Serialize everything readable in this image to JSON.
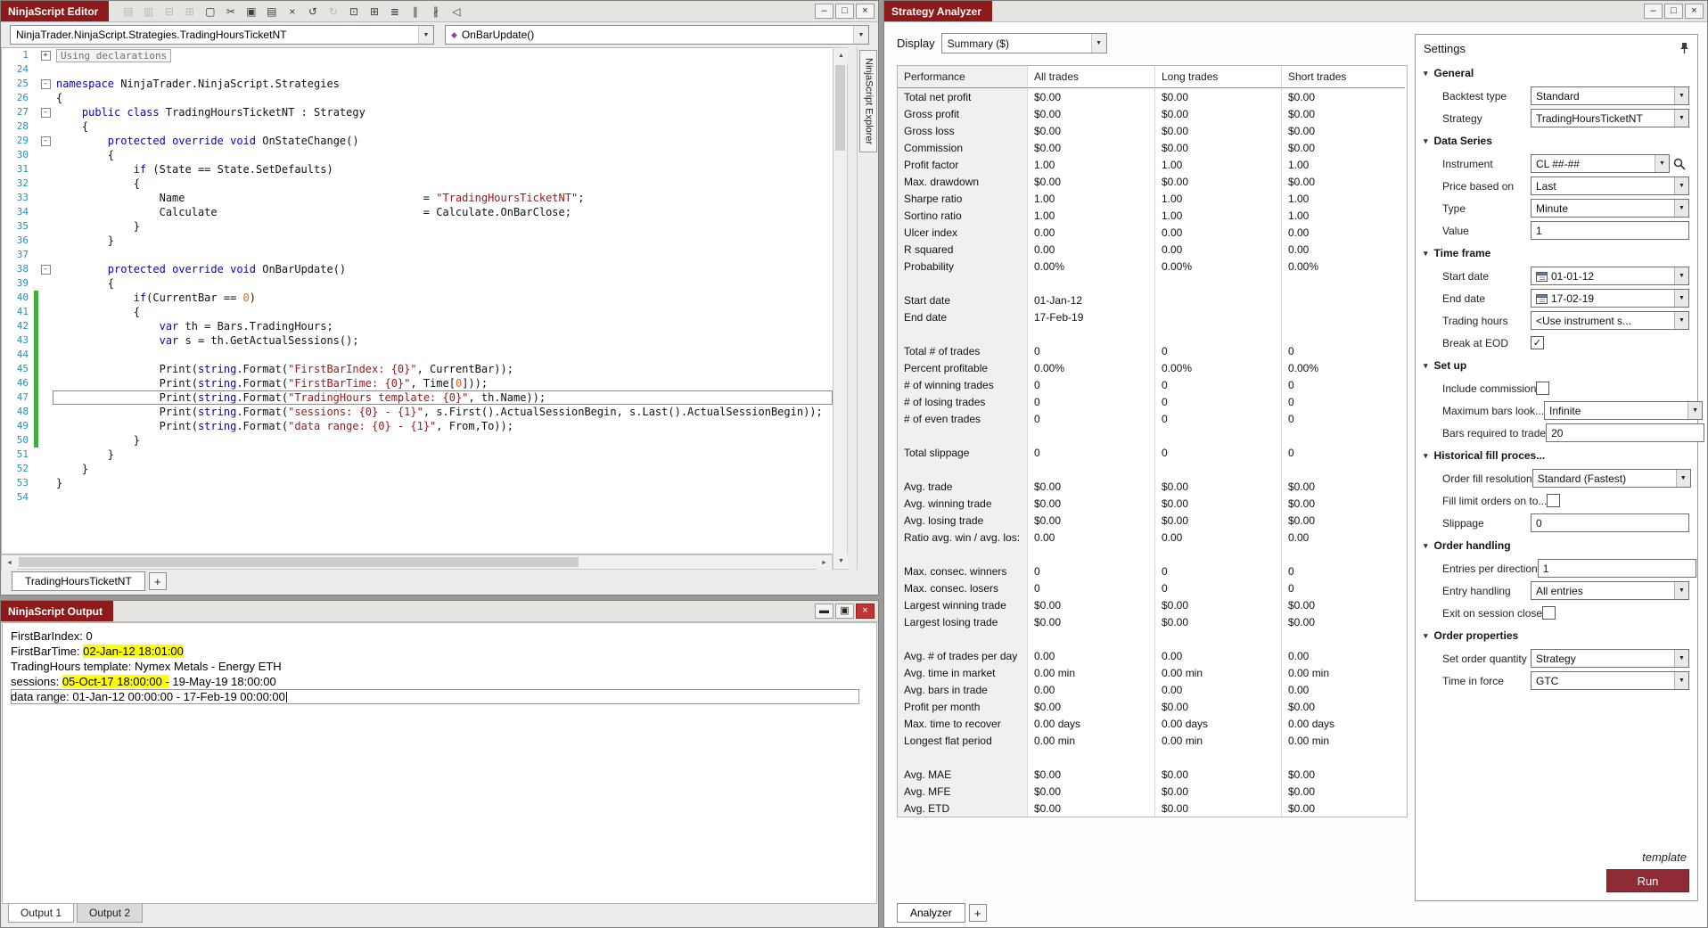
{
  "chrome": {
    "minimize": "–",
    "maximize": "□",
    "close": "×"
  },
  "editor": {
    "title": "NinjaScript Editor",
    "class_dropdown": "NinjaTrader.NinjaScript.Strategies.TradingHoursTicketNT",
    "method_dropdown": "OnBarUpdate()",
    "explorer_label": "NinjaScript Explorer",
    "tab": "TradingHoursTicketNT",
    "plus": "+",
    "toolbar": [
      {
        "name": "save-icon",
        "glyph": "▤",
        "disabled": true
      },
      {
        "name": "save-all-icon",
        "glyph": "▥",
        "disabled": true
      },
      {
        "name": "print-icon",
        "glyph": "⊟",
        "disabled": true
      },
      {
        "name": "print-preview-icon",
        "glyph": "⊞",
        "disabled": true
      },
      {
        "name": "new-file-icon",
        "glyph": "▢",
        "disabled": false
      },
      {
        "name": "cut-icon",
        "glyph": "✂",
        "disabled": false
      },
      {
        "name": "copy-icon",
        "glyph": "▣",
        "disabled": false
      },
      {
        "name": "paste-icon",
        "glyph": "▤",
        "disabled": false
      },
      {
        "name": "delete-icon",
        "glyph": "×",
        "disabled": false
      },
      {
        "name": "undo-icon",
        "glyph": "↺",
        "disabled": false
      },
      {
        "name": "redo-icon",
        "glyph": "↻",
        "disabled": true
      },
      {
        "name": "insert-snippet-icon",
        "glyph": "⊡",
        "disabled": false
      },
      {
        "name": "insert-table-icon",
        "glyph": "⊞",
        "disabled": false
      },
      {
        "name": "indent-icon",
        "glyph": "≣",
        "disabled": false
      },
      {
        "name": "comment-icon",
        "glyph": "∥",
        "disabled": false
      },
      {
        "name": "uncomment-icon",
        "glyph": "∦",
        "disabled": false
      },
      {
        "name": "compile-icon",
        "glyph": "◁",
        "disabled": false
      }
    ],
    "code": [
      {
        "n": 1,
        "f": "+",
        "s": [
          [
            "Using declarations",
            "c"
          ]
        ]
      },
      {
        "n": 24,
        "s": []
      },
      {
        "n": 25,
        "f": "-",
        "s": [
          [
            "namespace",
            "k"
          ],
          [
            " NinjaTrader.NinjaScript.Strategies",
            "p"
          ]
        ]
      },
      {
        "n": 26,
        "s": [
          [
            "{",
            "p"
          ]
        ]
      },
      {
        "n": 27,
        "f": "-",
        "s": [
          [
            "    ",
            "p"
          ],
          [
            "public",
            "k"
          ],
          [
            " ",
            "p"
          ],
          [
            "class",
            "k"
          ],
          [
            " TradingHoursTicketNT : Strategy",
            "p"
          ]
        ]
      },
      {
        "n": 28,
        "s": [
          [
            "    {",
            "p"
          ]
        ]
      },
      {
        "n": 29,
        "f": "-",
        "s": [
          [
            "        ",
            "p"
          ],
          [
            "protected",
            "k"
          ],
          [
            " ",
            "p"
          ],
          [
            "override",
            "k"
          ],
          [
            " ",
            "p"
          ],
          [
            "void",
            "k"
          ],
          [
            " OnStateChange()",
            "p"
          ]
        ]
      },
      {
        "n": 30,
        "s": [
          [
            "        {",
            "p"
          ]
        ]
      },
      {
        "n": 31,
        "s": [
          [
            "            ",
            "p"
          ],
          [
            "if",
            "k"
          ],
          [
            " (State == State.SetDefaults)",
            "p"
          ]
        ]
      },
      {
        "n": 32,
        "s": [
          [
            "            {",
            "p"
          ]
        ]
      },
      {
        "n": 33,
        "s": [
          [
            "                Name                                     = ",
            "p"
          ],
          [
            "\"TradingHoursTicketNT\"",
            "s"
          ],
          [
            ";",
            "p"
          ]
        ]
      },
      {
        "n": 34,
        "s": [
          [
            "                Calculate                                = Calculate.OnBarClose;",
            "p"
          ]
        ]
      },
      {
        "n": 35,
        "s": [
          [
            "            }",
            "p"
          ]
        ]
      },
      {
        "n": 36,
        "s": [
          [
            "        }",
            "p"
          ]
        ]
      },
      {
        "n": 37,
        "s": []
      },
      {
        "n": 38,
        "f": "-",
        "s": [
          [
            "        ",
            "p"
          ],
          [
            "protected",
            "k"
          ],
          [
            " ",
            "p"
          ],
          [
            "override",
            "k"
          ],
          [
            " ",
            "p"
          ],
          [
            "void",
            "k"
          ],
          [
            " OnBarUpdate()",
            "p"
          ]
        ]
      },
      {
        "n": 39,
        "s": [
          [
            "        {",
            "p"
          ]
        ]
      },
      {
        "n": 40,
        "chg": true,
        "s": [
          [
            "            ",
            "p"
          ],
          [
            "if",
            "k"
          ],
          [
            "(CurrentBar == ",
            "p"
          ],
          [
            "0",
            "n"
          ],
          [
            ")",
            "p"
          ]
        ]
      },
      {
        "n": 41,
        "chg": true,
        "s": [
          [
            "            {",
            "p"
          ]
        ]
      },
      {
        "n": 42,
        "chg": true,
        "s": [
          [
            "                ",
            "p"
          ],
          [
            "var",
            "k"
          ],
          [
            " th = Bars.TradingHours;",
            "p"
          ]
        ]
      },
      {
        "n": 43,
        "chg": true,
        "s": [
          [
            "                ",
            "p"
          ],
          [
            "var",
            "k"
          ],
          [
            " s = th.GetActualSessions();",
            "p"
          ]
        ]
      },
      {
        "n": 44,
        "chg": true,
        "s": []
      },
      {
        "n": 45,
        "chg": true,
        "s": [
          [
            "                Print(",
            "p"
          ],
          [
            "string",
            "k"
          ],
          [
            ".Format(",
            "p"
          ],
          [
            "\"FirstBarIndex: {0}\"",
            "s"
          ],
          [
            ", CurrentBar));",
            "p"
          ]
        ]
      },
      {
        "n": 46,
        "chg": true,
        "s": [
          [
            "                Print(",
            "p"
          ],
          [
            "string",
            "k"
          ],
          [
            ".Format(",
            "p"
          ],
          [
            "\"FirstBarTime: {0}\"",
            "s"
          ],
          [
            ", Time[",
            "p"
          ],
          [
            "0",
            "n"
          ],
          [
            "]));",
            "p"
          ]
        ]
      },
      {
        "n": 47,
        "chg": true,
        "cur": true,
        "s": [
          [
            "                Print(",
            "p"
          ],
          [
            "string",
            "k"
          ],
          [
            ".Format(",
            "p"
          ],
          [
            "\"TradingHours template: {0}\"",
            "s"
          ],
          [
            ", th.Name));",
            "p"
          ]
        ]
      },
      {
        "n": 48,
        "chg": true,
        "s": [
          [
            "                Print(",
            "p"
          ],
          [
            "string",
            "k"
          ],
          [
            ".Format(",
            "p"
          ],
          [
            "\"sessions: {0} - {1}\"",
            "s"
          ],
          [
            ", s.First().ActualSessionBegin, s.Last().ActualSessionBegin));",
            "p"
          ]
        ]
      },
      {
        "n": 49,
        "chg": true,
        "s": [
          [
            "                Print(",
            "p"
          ],
          [
            "string",
            "k"
          ],
          [
            ".Format(",
            "p"
          ],
          [
            "\"data range: {0} - {1}\"",
            "s"
          ],
          [
            ", From,To));",
            "p"
          ]
        ]
      },
      {
        "n": 50,
        "chg": true,
        "s": [
          [
            "            }",
            "p"
          ]
        ]
      },
      {
        "n": 51,
        "s": [
          [
            "        }",
            "p"
          ]
        ]
      },
      {
        "n": 52,
        "s": [
          [
            "    }",
            "p"
          ]
        ]
      },
      {
        "n": 53,
        "s": [
          [
            "}",
            "p"
          ]
        ]
      },
      {
        "n": 54,
        "s": []
      }
    ]
  },
  "output": {
    "title": "NinjaScript Output",
    "tabs": [
      "Output 1",
      "Output 2"
    ],
    "lines": [
      {
        "segs": [
          {
            "t": "FirstBarIndex: 0"
          }
        ]
      },
      {
        "segs": [
          {
            "t": "FirstBarTime: "
          },
          {
            "t": "02-Jan-12 18:01:00",
            "hl": true
          }
        ]
      },
      {
        "segs": [
          {
            "t": "TradingHours template: Nymex Metals - Energy ETH"
          }
        ]
      },
      {
        "segs": [
          {
            "t": "sessions: "
          },
          {
            "t": "05-Oct-17 18:00:00 -",
            "hl": true
          },
          {
            "t": " 19-May-19 18:00:00"
          }
        ]
      },
      {
        "segs": [
          {
            "t": "data range: 01-Jan-12 00:00:00 - 17-Feb-19 00:00:00"
          }
        ],
        "box": true,
        "caret": true
      }
    ]
  },
  "analyzer": {
    "title": "Strategy Analyzer",
    "display_label": "Display",
    "display_value": "Summary ($)",
    "tab": "Analyzer",
    "plus": "+",
    "table": {
      "headers": [
        "Performance",
        "All trades",
        "Long trades",
        "Short trades"
      ],
      "rows": [
        [
          "Total net profit",
          "$0.00",
          "$0.00",
          "$0.00"
        ],
        [
          "Gross profit",
          "$0.00",
          "$0.00",
          "$0.00"
        ],
        [
          "Gross loss",
          "$0.00",
          "$0.00",
          "$0.00"
        ],
        [
          "Commission",
          "$0.00",
          "$0.00",
          "$0.00"
        ],
        [
          "Profit factor",
          "1.00",
          "1.00",
          "1.00"
        ],
        [
          "Max. drawdown",
          "$0.00",
          "$0.00",
          "$0.00"
        ],
        [
          "Sharpe ratio",
          "1.00",
          "1.00",
          "1.00"
        ],
        [
          "Sortino ratio",
          "1.00",
          "1.00",
          "1.00"
        ],
        [
          "Ulcer index",
          "0.00",
          "0.00",
          "0.00"
        ],
        [
          "R squared",
          "0.00",
          "0.00",
          "0.00"
        ],
        [
          "Probability",
          "0.00%",
          "0.00%",
          "0.00%"
        ],
        [
          "",
          "",
          "",
          ""
        ],
        [
          "Start date",
          "01-Jan-12",
          "",
          ""
        ],
        [
          "End date",
          "17-Feb-19",
          "",
          ""
        ],
        [
          "",
          "",
          "",
          ""
        ],
        [
          "Total # of trades",
          "0",
          "0",
          "0"
        ],
        [
          "Percent profitable",
          "0.00%",
          "0.00%",
          "0.00%"
        ],
        [
          "# of winning trades",
          "0",
          "0",
          "0"
        ],
        [
          "# of losing trades",
          "0",
          "0",
          "0"
        ],
        [
          "# of even trades",
          "0",
          "0",
          "0"
        ],
        [
          "",
          "",
          "",
          ""
        ],
        [
          "Total slippage",
          "0",
          "0",
          "0"
        ],
        [
          "",
          "",
          "",
          ""
        ],
        [
          "Avg. trade",
          "$0.00",
          "$0.00",
          "$0.00"
        ],
        [
          "Avg. winning trade",
          "$0.00",
          "$0.00",
          "$0.00"
        ],
        [
          "Avg. losing trade",
          "$0.00",
          "$0.00",
          "$0.00"
        ],
        [
          "Ratio avg. win / avg. los:",
          "0.00",
          "0.00",
          "0.00"
        ],
        [
          "",
          "",
          "",
          ""
        ],
        [
          "Max. consec. winners",
          "0",
          "0",
          "0"
        ],
        [
          "Max. consec. losers",
          "0",
          "0",
          "0"
        ],
        [
          "Largest winning trade",
          "$0.00",
          "$0.00",
          "$0.00"
        ],
        [
          "Largest losing trade",
          "$0.00",
          "$0.00",
          "$0.00"
        ],
        [
          "",
          "",
          "",
          ""
        ],
        [
          "Avg. # of trades per day",
          "0.00",
          "0.00",
          "0.00"
        ],
        [
          "Avg. time in market",
          "0.00 min",
          "0.00 min",
          "0.00 min"
        ],
        [
          "Avg. bars in trade",
          "0.00",
          "0.00",
          "0.00"
        ],
        [
          "Profit per month",
          "$0.00",
          "$0.00",
          "$0.00"
        ],
        [
          "Max. time to recover",
          "0.00 days",
          "0.00 days",
          "0.00 days"
        ],
        [
          "Longest flat period",
          "0.00 min",
          "0.00 min",
          "0.00 min"
        ],
        [
          "",
          "",
          "",
          ""
        ],
        [
          "Avg. MAE",
          "$0.00",
          "$0.00",
          "$0.00"
        ],
        [
          "Avg. MFE",
          "$0.00",
          "$0.00",
          "$0.00"
        ],
        [
          "Avg. ETD",
          "$0.00",
          "$0.00",
          "$0.00"
        ]
      ]
    }
  },
  "settings": {
    "title": "Settings",
    "template_label": "template",
    "run_label": "Run",
    "groups": [
      {
        "label": "General",
        "items": [
          {
            "label": "Backtest type",
            "type": "select",
            "value": "Standard"
          },
          {
            "label": "Strategy",
            "type": "select",
            "value": "TradingHoursTicketNT"
          }
        ]
      },
      {
        "label": "Data Series",
        "items": [
          {
            "label": "Instrument",
            "type": "select-search",
            "value": "CL ##-##"
          },
          {
            "label": "Price based on",
            "type": "select",
            "value": "Last"
          },
          {
            "label": "Type",
            "type": "select",
            "value": "Minute"
          },
          {
            "label": "Value",
            "type": "input",
            "value": "1"
          }
        ]
      },
      {
        "label": "Time frame",
        "items": [
          {
            "label": "Start date",
            "type": "date",
            "value": "01-01-12"
          },
          {
            "label": "End date",
            "type": "date",
            "value": "17-02-19"
          },
          {
            "label": "Trading hours",
            "type": "select",
            "value": "<Use instrument s..."
          },
          {
            "label": "Break at EOD",
            "type": "checkbox",
            "checked": true
          }
        ]
      },
      {
        "label": "Set up",
        "items": [
          {
            "label": "Include commission",
            "type": "checkbox",
            "checked": false
          },
          {
            "label": "Maximum bars look...",
            "type": "select",
            "value": "Infinite"
          },
          {
            "label": "Bars required to trade",
            "type": "input",
            "value": "20"
          }
        ]
      },
      {
        "label": "Historical fill proces...",
        "items": [
          {
            "label": "Order fill resolution",
            "type": "select",
            "value": "Standard (Fastest)"
          },
          {
            "label": "Fill limit orders on to...",
            "type": "checkbox",
            "checked": false
          },
          {
            "label": "Slippage",
            "type": "input",
            "value": "0"
          }
        ]
      },
      {
        "label": "Order handling",
        "items": [
          {
            "label": "Entries per direction",
            "type": "input",
            "value": "1"
          },
          {
            "label": "Entry handling",
            "type": "select",
            "value": "All entries"
          },
          {
            "label": "Exit on session close",
            "type": "checkbox",
            "checked": false
          }
        ]
      },
      {
        "label": "Order properties",
        "items": [
          {
            "label": "Set order quantity",
            "type": "select",
            "value": "Strategy"
          },
          {
            "label": "Time in force",
            "type": "select",
            "value": "GTC"
          }
        ]
      }
    ]
  }
}
